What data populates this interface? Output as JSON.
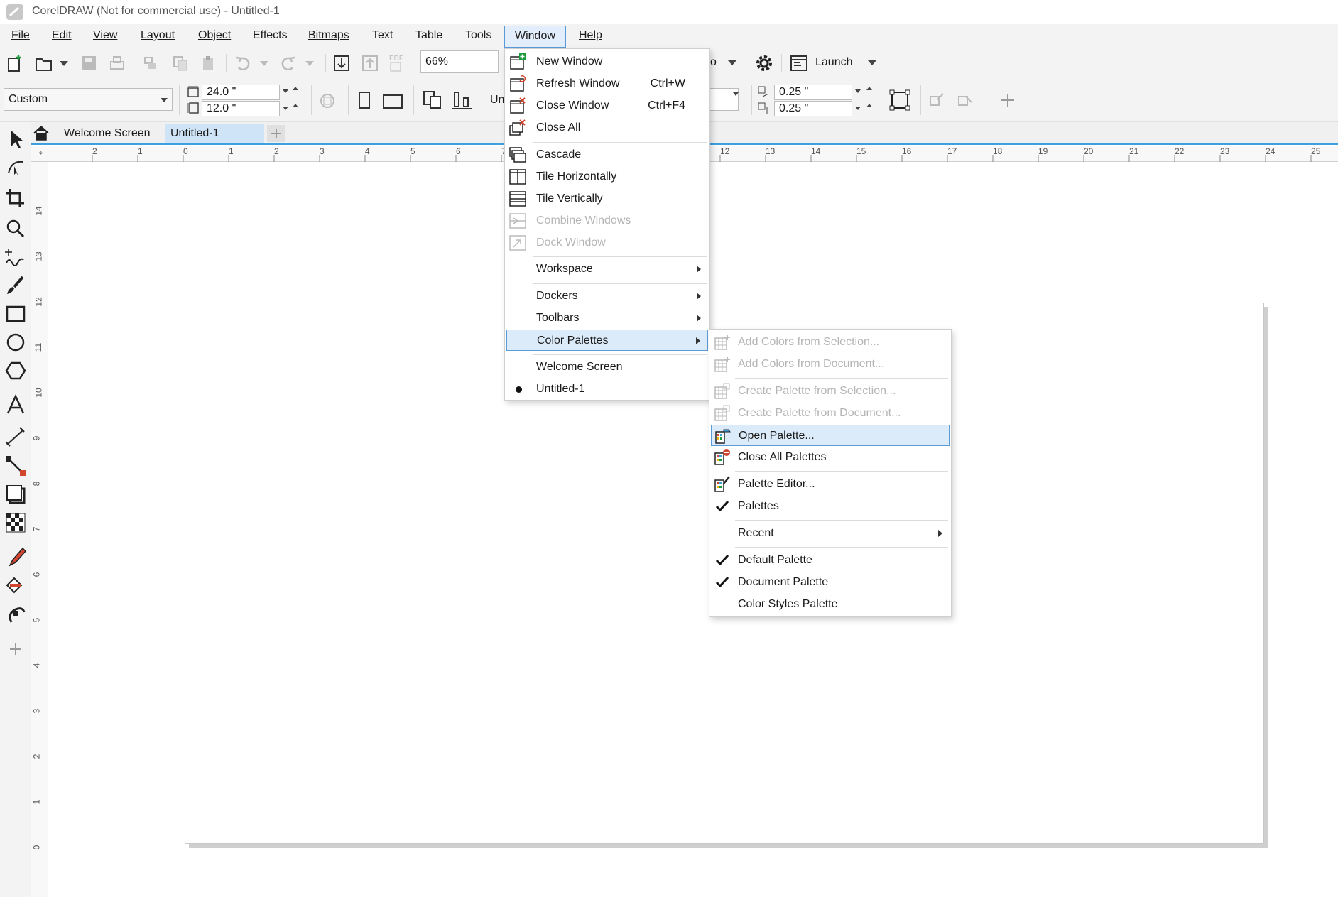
{
  "window": {
    "title": "CorelDRAW (Not for commercial use) - Untitled-1"
  },
  "menubar": {
    "items": [
      "File",
      "Edit",
      "View",
      "Layout",
      "Object",
      "Effects",
      "Bitmaps",
      "Text",
      "Table",
      "Tools",
      "Window",
      "Help"
    ],
    "active": "Window"
  },
  "toolbar1": {
    "zoom_value": "66%",
    "launch_label": "Launch",
    "snap_partial": "o"
  },
  "toolbar2": {
    "page_size": "Custom",
    "width": "24.0 \"",
    "height": "12.0 \"",
    "units_partial": "Un",
    "nudge_x": "0.25 \"",
    "nudge_y": "0.25 \""
  },
  "tabs": {
    "welcome": "Welcome Screen",
    "document": "Untitled-1"
  },
  "rulers": {
    "horizontal": [
      "2",
      "1",
      "0",
      "1",
      "2",
      "3",
      "4",
      "5",
      "6",
      "7",
      "12",
      "13",
      "14",
      "15",
      "16",
      "17",
      "18",
      "19",
      "20",
      "21",
      "22",
      "23",
      "24",
      "25"
    ],
    "vertical": [
      "14",
      "13",
      "12",
      "11",
      "10",
      "9",
      "8",
      "7",
      "6",
      "5",
      "4",
      "3",
      "2",
      "1",
      "0"
    ]
  },
  "window_menu": {
    "new_window": "New Window",
    "refresh_window": "Refresh Window",
    "refresh_shortcut": "Ctrl+W",
    "close_window": "Close Window",
    "close_shortcut": "Ctrl+F4",
    "close_all": "Close All",
    "cascade": "Cascade",
    "tile_h": "Tile Horizontally",
    "tile_v": "Tile Vertically",
    "combine": "Combine Windows",
    "dock": "Dock Window",
    "workspace": "Workspace",
    "dockers": "Dockers",
    "toolbars": "Toolbars",
    "color_palettes": "Color Palettes",
    "welcome_screen": "Welcome Screen",
    "untitled": "Untitled-1"
  },
  "palettes_menu": {
    "add_from_selection": "Add Colors from Selection...",
    "add_from_document": "Add Colors from Document...",
    "create_from_selection": "Create Palette from Selection...",
    "create_from_document": "Create Palette from Document...",
    "open_palette": "Open Palette...",
    "close_all": "Close All Palettes",
    "palette_editor": "Palette Editor...",
    "palettes": "Palettes",
    "recent": "Recent",
    "default_palette": "Default Palette",
    "document_palette": "Document Palette",
    "color_styles_palette": "Color Styles Palette"
  },
  "colors": {
    "accent": "#5b9bd5",
    "highlight": "#dcebfa",
    "disabled_text": "#b5b5b5"
  }
}
